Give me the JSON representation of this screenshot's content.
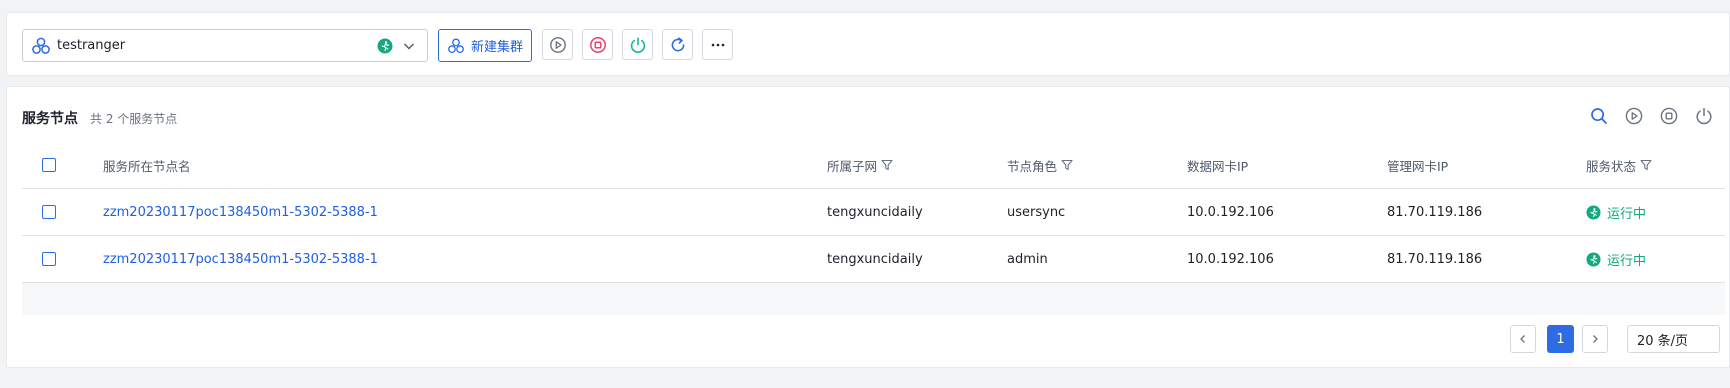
{
  "cluster": {
    "name": "testranger",
    "icon": "cluster-icon",
    "status_icon": "running-status-icon"
  },
  "toolbar": {
    "new_cluster_label": "新建集群",
    "buttons": [
      "play-circle-icon",
      "stop-circle-icon",
      "power-icon",
      "refresh-icon",
      "more-icon"
    ],
    "colors": {
      "primary": "#2e6ce6",
      "stop": "#e8426e",
      "power": "#16b89a",
      "running": "#13a880"
    }
  },
  "panel": {
    "title": "服务节点",
    "count_text": "共 2 个服务节点",
    "header_icons": [
      "search-icon",
      "play-circle-icon",
      "stop-circle-icon",
      "power-icon"
    ]
  },
  "table": {
    "columns": [
      "服务所在节点名",
      "所属子网",
      "节点角色",
      "数据网卡IP",
      "管理网卡IP",
      "服务状态"
    ],
    "filterable": [
      "所属子网",
      "节点角色",
      "服务状态"
    ],
    "rows": [
      {
        "node": "zzm20230117poc138450m1-5302-5388-1",
        "subnet": "tengxuncidaily",
        "role": "usersync",
        "data_ip": "10.0.192.106",
        "mgmt_ip": "81.70.119.186",
        "status": "运行中"
      },
      {
        "node": "zzm20230117poc138450m1-5302-5388-1",
        "subnet": "tengxuncidaily",
        "role": "admin",
        "data_ip": "10.0.192.106",
        "mgmt_ip": "81.70.119.186",
        "status": "运行中"
      }
    ]
  },
  "pagination": {
    "current_page": "1",
    "page_size": "20 条/页"
  }
}
